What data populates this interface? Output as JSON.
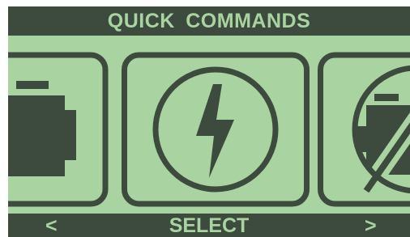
{
  "title": "QUICK COMMANDS",
  "navigation": {
    "prev_label": "<",
    "select_label": "SELECT",
    "next_label": ">"
  },
  "commands": [
    {
      "icon": "engine-icon",
      "state": "partially visible (left)"
    },
    {
      "icon": "lightning-bolt-icon",
      "state": "selected"
    },
    {
      "icon": "no-engine-icon",
      "state": "partially visible (right)"
    }
  ],
  "colors": {
    "background": "#a9d3a1",
    "foreground": "#3d4a3e"
  }
}
